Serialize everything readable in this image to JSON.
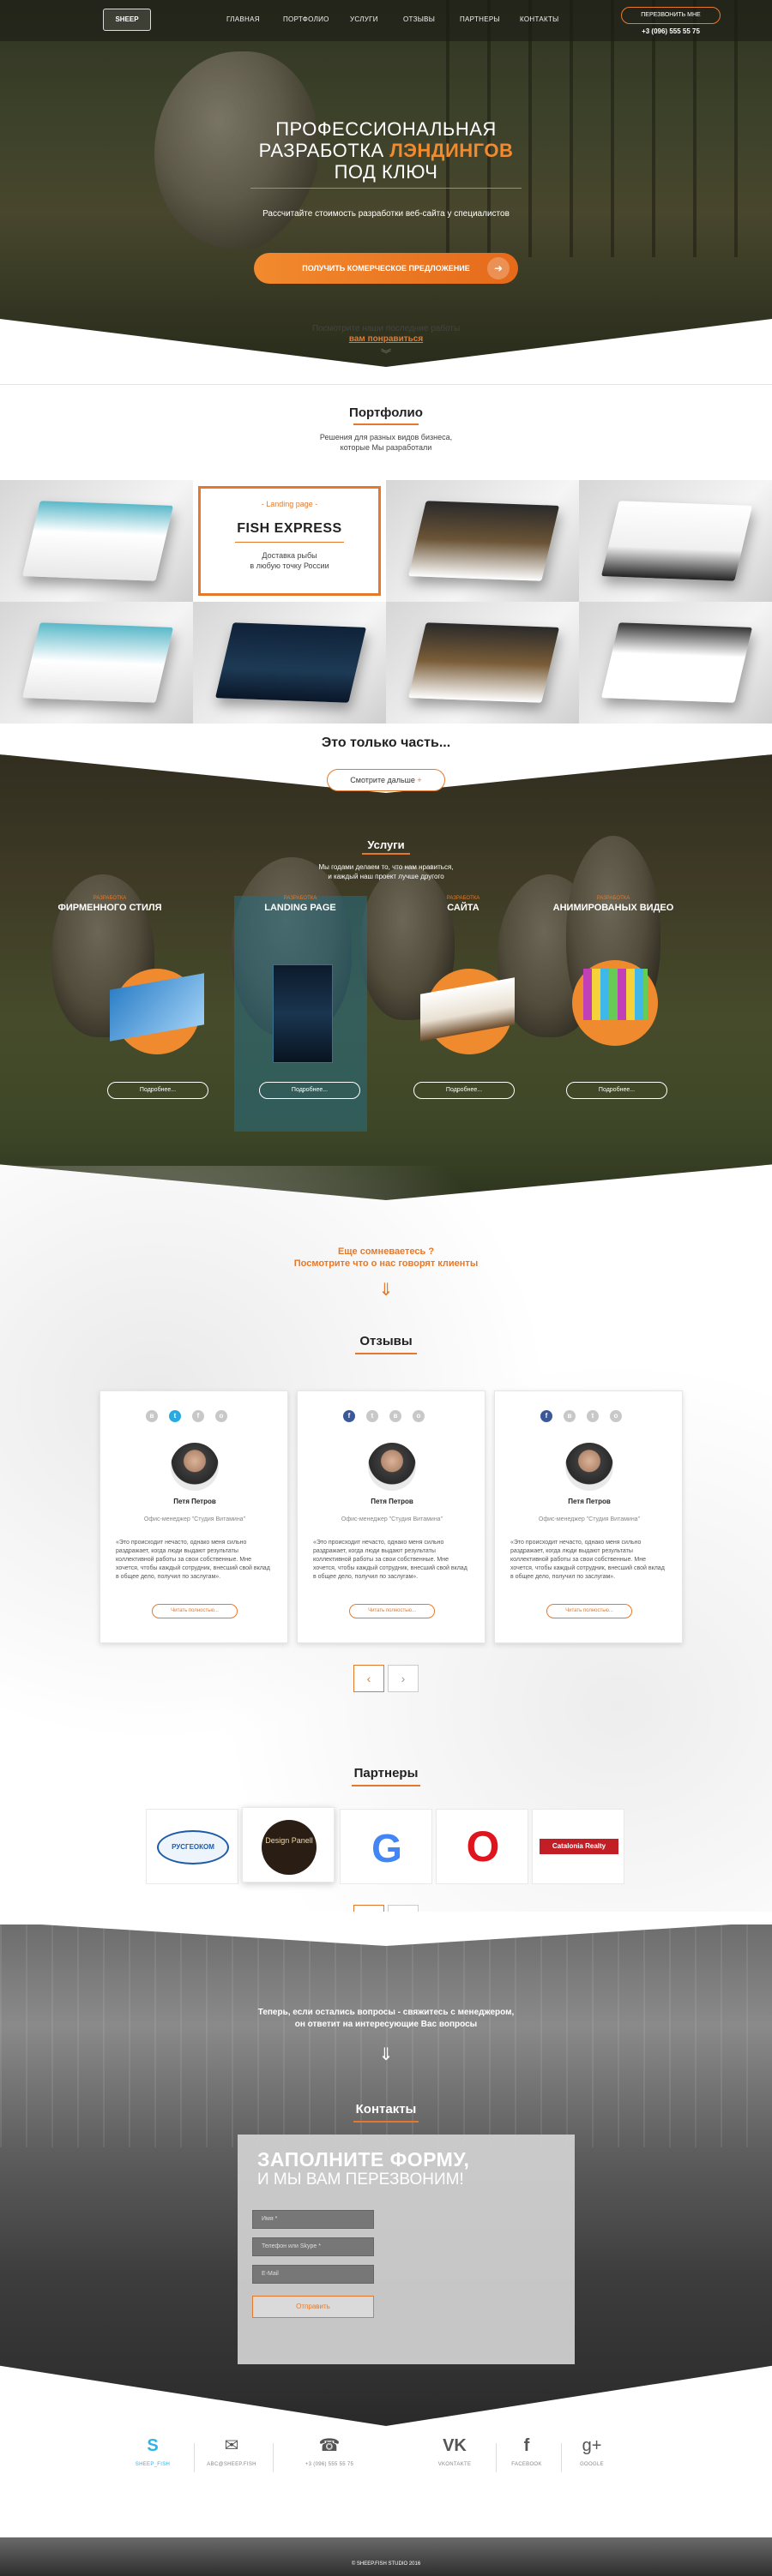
{
  "nav": {
    "logo": "SHEEP",
    "links": [
      "Главная",
      "Портфолио",
      "Услуги",
      "Отзывы",
      "Партнеры",
      "Контакты"
    ],
    "call_button": "Перезвонить мне",
    "phone": "+3 (096) 555 55 75"
  },
  "hero": {
    "title_line1": "Профессиональная",
    "title_line2_a": "разработка",
    "title_line2_b": "лэндингов",
    "title_line3": "под ключ",
    "subtitle": "Рассчитайте стоимость разработки веб-сайта у специалистов",
    "cta": "Получить комерческое предложение",
    "see_works": "Посмотрите наши последние работы",
    "see_works_link": "вам понравиться"
  },
  "portfolio": {
    "title": "Портфолио",
    "desc_line1": "Решения для разных видов бизнеса,",
    "desc_line2": "которые Мы разработали",
    "featured": {
      "tag": "- Landing page -",
      "title": "FISH EXPRESS",
      "desc_line1": "Доставка рыбы",
      "desc_line2": "в любую точку России"
    },
    "part_title": "Это только часть...",
    "more_button": "Смотрите дальше"
  },
  "services": {
    "title": "Услуги",
    "desc_line1": "Мы годами делаем то, что нам нравиться,",
    "desc_line2": "и каждый наш проект лучше другого",
    "items": [
      {
        "tag": "РАЗРАБОТКА",
        "name": "Фирменного стиля",
        "button": "Подробнее..."
      },
      {
        "tag": "РАЗРАБОТКА",
        "name": "Landing page",
        "button": "Подробнее..."
      },
      {
        "tag": "РАЗРАБОТКА",
        "name": "Сайта",
        "button": "Подробнее..."
      },
      {
        "tag": "РАЗРАБОТКА",
        "name": "Анимированых видео",
        "button": "Подробнее..."
      }
    ]
  },
  "doubt": {
    "line1": "Еще сомневаетесь ?",
    "line2": "Посмотрите что о нас говорят клиенты"
  },
  "reviews": {
    "title": "Отзывы",
    "items": [
      {
        "name": "Петя Петров",
        "role": "Офис-менеджер \"Студия Витамина\"",
        "text": "«Это происходит нечасто, однако меня сильно раздражает, когда люди выдают результаты коллективной работы за свои собственные. Мне хочется, чтобы каждый сотрудник, внесший свой вклад в общее дело, получил по заслугам».",
        "button": "Читать полностью..."
      },
      {
        "name": "Петя Петров",
        "role": "Офис-менеджер \"Студия Витамина\"",
        "text": "«Это происходит нечасто, однако меня сильно раздражает, когда люди выдают результаты коллективной работы за свои собственные. Мне хочется, чтобы каждый сотрудник, внесший свой вклад в общее дело, получил по заслугам».",
        "button": "Читать полностью..."
      },
      {
        "name": "Петя Петров",
        "role": "Офис-менеджер \"Студия Витамина\"",
        "text": "«Это происходит нечасто, однако меня сильно раздражает, когда люди выдают результаты коллективной работы за свои собственные. Мне хочется, чтобы каждый сотрудник, внесший свой вклад в общее дело, получил по заслугам».",
        "button": "Читать полностью..."
      }
    ],
    "prev": "‹",
    "next": "›"
  },
  "partners": {
    "title": "Партнеры",
    "items": [
      "РУСГЕОКОМ",
      "Design Panell",
      "G",
      "O",
      "Catalonia Realty"
    ],
    "prev": "‹",
    "next": "›"
  },
  "contacts": {
    "question_line1": "Теперь, если остались вопросы - свяжитесь с менеджером,",
    "question_line2": "он ответит на интересующие Вас вопросы",
    "title": "Контакты",
    "form_title1": "Заполните форму,",
    "form_title2": "и мы вам перезвоним!",
    "name_placeholder": "Имя *",
    "phone_placeholder": "Телефон или Skype *",
    "email_placeholder": "E-Mail",
    "submit": "Отправить"
  },
  "footer": {
    "items": [
      {
        "icon": "skype-icon",
        "glyph": "S",
        "label": "sheep_fish"
      },
      {
        "icon": "mail-icon",
        "glyph": "✉",
        "label": "ABC@SHEEP.FISH"
      },
      {
        "icon": "phone-icon",
        "glyph": "☎",
        "label": "+3 (096) 555 55 75"
      },
      {
        "icon": "vk-icon",
        "glyph": "VK",
        "label": "VKONTAKTE"
      },
      {
        "icon": "facebook-icon",
        "glyph": "f",
        "label": "FACEBOOK"
      },
      {
        "icon": "google-plus-icon",
        "glyph": "g+",
        "label": "GOOGLE"
      }
    ],
    "copyright": "© SHEEP.FISH STUDIO 2016"
  },
  "colors": {
    "accent": "#e5792b",
    "skype": "#2fb4e9"
  }
}
